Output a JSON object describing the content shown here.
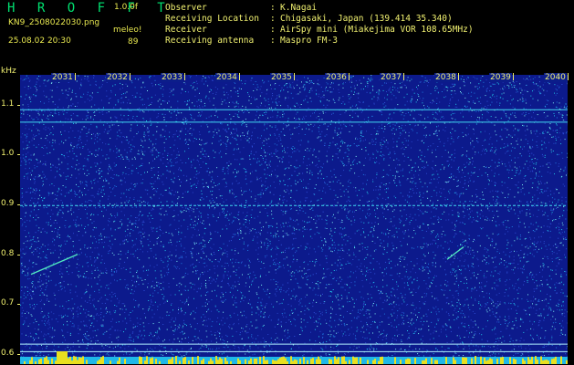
{
  "header": {
    "app_name": "H R O F F T",
    "version": "1.0.0f",
    "filename": "KN9_2508022030.png",
    "datetime": "25.08.02 20:30",
    "meteor_label": "meleo!",
    "meteor_count": "89"
  },
  "info": {
    "labels": [
      "Observer",
      "Receiving Location",
      "Receiver",
      "Receiving antenna"
    ],
    "separators": [
      ":",
      ":",
      ":",
      ":"
    ],
    "values": [
      "K.Nagai",
      "Chigasaki, Japan (139.414 35.340)",
      "AirSpy mini (Miakejima VOR 108.65MHz)",
      "Maspro FM-3"
    ]
  },
  "chart_data": {
    "type": "heatmap",
    "ylabel": "kHz",
    "y_ticks": [
      "1.1",
      "1.0",
      "0.9",
      "0.8",
      "0.7",
      "0.6"
    ],
    "y_tick_values": [
      1.1,
      1.0,
      0.9,
      0.8,
      0.7,
      0.6
    ],
    "x_ticks": [
      "2031",
      "2032",
      "2033",
      "2034",
      "2035",
      "2036",
      "2037",
      "2038",
      "2039",
      "2040"
    ],
    "ylim": [
      0.58,
      1.16
    ],
    "xlim": [
      2030,
      2040
    ],
    "horizontal_lines_khz": [
      1.09,
      1.065,
      0.898,
      0.62,
      0.605
    ],
    "meteor_traces": [
      {
        "x": [
          2030.2,
          2031.05
        ],
        "y": [
          0.76,
          0.8
        ]
      },
      {
        "x": [
          2037.8,
          2038.1
        ],
        "y": [
          0.79,
          0.815
        ]
      }
    ],
    "colors": {
      "background": "#0c1a8c",
      "noise": "#22c8e8",
      "text": "#f0f070",
      "bottom_band": "#e8e020"
    }
  }
}
